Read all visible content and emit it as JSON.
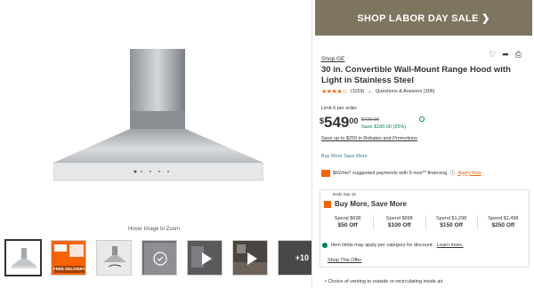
{
  "gallery": {
    "hover_hint": "Hover Image to Zoom",
    "thumbnails": [
      {
        "name": "range-hood-front"
      },
      {
        "name": "free-delivery-promo",
        "promo_text": "FREE DELIVERY"
      },
      {
        "name": "range-hood-angle"
      },
      {
        "name": "range-hood-360"
      },
      {
        "name": "video"
      },
      {
        "name": "kitchen-video"
      },
      {
        "name": "more-images",
        "count": "+10"
      }
    ]
  },
  "panel": {
    "banner": "SHOP LABOR DAY SALE ❯",
    "brand": "Shop GE",
    "title": "30 in. Convertible Wall-Mount Range Hood with Light in Stainless Steel",
    "rating": {
      "stars": "★★★★☆",
      "count": "(1159)",
      "qa": "Questions & Answers (306)"
    },
    "limit": "Limit 6 per order",
    "price": {
      "dollar": "$",
      "whole": "549",
      "cents": "00",
      "was": "$729.00",
      "save": "Save $180.00 (25%)"
    },
    "rebates": "Save up to $250 in Rebates and Promotions",
    "buy_more": "Buy More Save More",
    "financing": {
      "text": "$92/mo* suggested payments with 6 mos** financing",
      "apply": "Apply Now"
    },
    "promo": {
      "ends": "Ends Sep 15",
      "title": "Buy More, Save More",
      "tiers": [
        {
          "spend": "Spend $698",
          "off": "$50 Off"
        },
        {
          "spend": "Spend $998",
          "off": "$100 Off"
        },
        {
          "spend": "Spend $1,298",
          "off": "$150 Off"
        },
        {
          "spend": "Spend $1,498",
          "off": "$250 Off"
        }
      ],
      "note": "Item limits may apply per category for discount.",
      "learn_more": "Learn more.",
      "shop_offer": "Shop This Offer"
    },
    "bullet": "•  Choice of venting to outside or recirculating inside air"
  },
  "colors": {
    "banner_bg": "#7d7560",
    "accent_orange": "#f96302",
    "save_green": "#00805d",
    "link_blue": "#3e7697"
  }
}
